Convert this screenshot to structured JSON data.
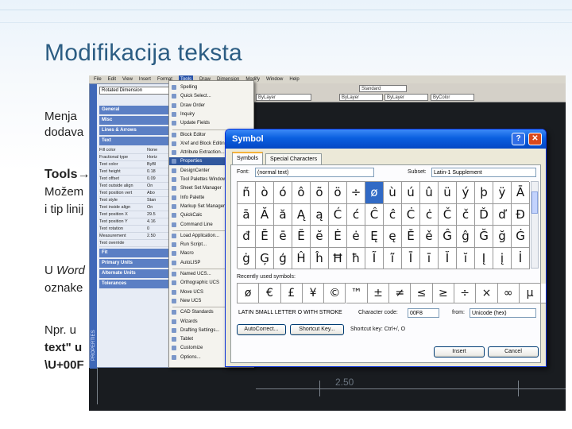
{
  "slide": {
    "title": "Modifikacija teksta",
    "lines": [
      {
        "text": "Menja"
      },
      {
        "text": "dodava"
      },
      {
        "text": "Tools→"
      },
      {
        "text": "Možem"
      },
      {
        "text": "i tip linij"
      },
      {
        "prefix": "U ",
        "ital": "Word"
      },
      {
        "text": "oznake"
      },
      {
        "text": "Npr.  u"
      },
      {
        "text": "text\"  u"
      },
      {
        "text": "\\U+00F"
      }
    ]
  },
  "autocad": {
    "menus": [
      "File",
      "Edit",
      "View",
      "Insert",
      "Format",
      "Tools",
      "Draw",
      "Dimension",
      "Modify",
      "Window",
      "Help"
    ],
    "active_menu": "Tools",
    "toolbar": {
      "style_combo": "Standard",
      "layer_combo": "ByLayer",
      "linetype_combo": "ByLayer",
      "lineweight_combo": "ByLayer",
      "color_combo": "ByColor"
    },
    "dimension_text": "2.50"
  },
  "properties": {
    "object_combo": "Rotated Dimension",
    "side_label": "PROPERTIES",
    "sections": [
      "General",
      "Misc",
      "Lines & Arrows",
      "Text",
      "Fit",
      "Primary Units",
      "Alternate Units",
      "Tolerances"
    ],
    "text_rows": [
      {
        "name": "Fill color",
        "value": "None"
      },
      {
        "name": "Fractional type",
        "value": "Horiz"
      },
      {
        "name": "Text color",
        "value": "ByBl"
      },
      {
        "name": "Text height",
        "value": "0.18"
      },
      {
        "name": "Text offset",
        "value": "0.09"
      },
      {
        "name": "Text outside align",
        "value": "On"
      },
      {
        "name": "Text position vert",
        "value": "Abo"
      },
      {
        "name": "Text style",
        "value": "Stan"
      },
      {
        "name": "Text inside align",
        "value": "On"
      },
      {
        "name": "Text position X",
        "value": "29.5"
      },
      {
        "name": "Text position Y",
        "value": "4.16"
      },
      {
        "name": "Text rotation",
        "value": "0"
      },
      {
        "name": "Measurement",
        "value": "2.50"
      },
      {
        "name": "Text override",
        "value": ""
      }
    ]
  },
  "tools_menu": {
    "items": [
      "Spelling",
      "Quick Select...",
      "Draw Order",
      "Inquiry",
      "Update Fields",
      "Block Editor",
      "Xref and Block Editing",
      "Attribute Extraction...",
      "Properties",
      "DesignCenter",
      "Tool Palettes Window",
      "Sheet Set Manager",
      "Info Palette",
      "Markup Set Manager",
      "QuickCalc",
      "Command Line",
      "Load Application...",
      "Run Script...",
      "Macro",
      "AutoLISP",
      "Named UCS...",
      "Orthographic UCS",
      "Move UCS",
      "New UCS",
      "CAD Standards",
      "Wizards",
      "Drafting Settings...",
      "Tablet",
      "Customize",
      "Options..."
    ],
    "selected": "Properties"
  },
  "symbol_dialog": {
    "title": "Symbol",
    "help_glyph": "?",
    "close_glyph": "✕",
    "tabs": [
      "Symbols",
      "Special Characters"
    ],
    "font_label": "Font:",
    "font_value": "(normal text)",
    "subset_label": "Subset:",
    "subset_value": "Latin-1 Supplement",
    "symbols": [
      [
        "ñ",
        "ò",
        "ó",
        "ô",
        "õ",
        "ö",
        "÷",
        "ø",
        "ù",
        "ú",
        "û",
        "ü",
        "ý",
        "þ",
        "ÿ",
        "Ā"
      ],
      [
        "ā",
        "Ă",
        "ă",
        "Ą",
        "ą",
        "Ć",
        "ć",
        "Ĉ",
        "ĉ",
        "Ċ",
        "ċ",
        "Č",
        "č",
        "Ď",
        "ď",
        "Đ"
      ],
      [
        "đ",
        "Ē",
        "ē",
        "Ĕ",
        "ĕ",
        "Ė",
        "ė",
        "Ę",
        "ę",
        "Ě",
        "ě",
        "Ĝ",
        "ĝ",
        "Ğ",
        "ğ",
        "Ġ"
      ],
      [
        "ġ",
        "Ģ",
        "ģ",
        "Ĥ",
        "ĥ",
        "Ħ",
        "ħ",
        "Ĩ",
        "ĩ",
        "Ī",
        "ī",
        "Ĭ",
        "ĭ",
        "Į",
        "į",
        "İ"
      ]
    ],
    "selected_symbol": "ø",
    "recent_label": "Recently used symbols:",
    "recent": [
      "ø",
      "€",
      "£",
      "¥",
      "©",
      "™",
      "±",
      "≠",
      "≤",
      "≥",
      "÷",
      "×",
      "∞",
      "µ",
      "α"
    ],
    "char_name": "LATIN SMALL LETTER O WITH STROKE",
    "char_code_label": "Character code:",
    "char_code": "00F8",
    "from_label": "from:",
    "from_value": "Unicode (hex)",
    "autocorrect_label": "AutoCorrect...",
    "shortcut_key_label": "Shortcut Key...",
    "shortcut_text": "Shortcut key: Ctrl+/, O",
    "insert_label": "Insert",
    "cancel_label": "Cancel"
  }
}
